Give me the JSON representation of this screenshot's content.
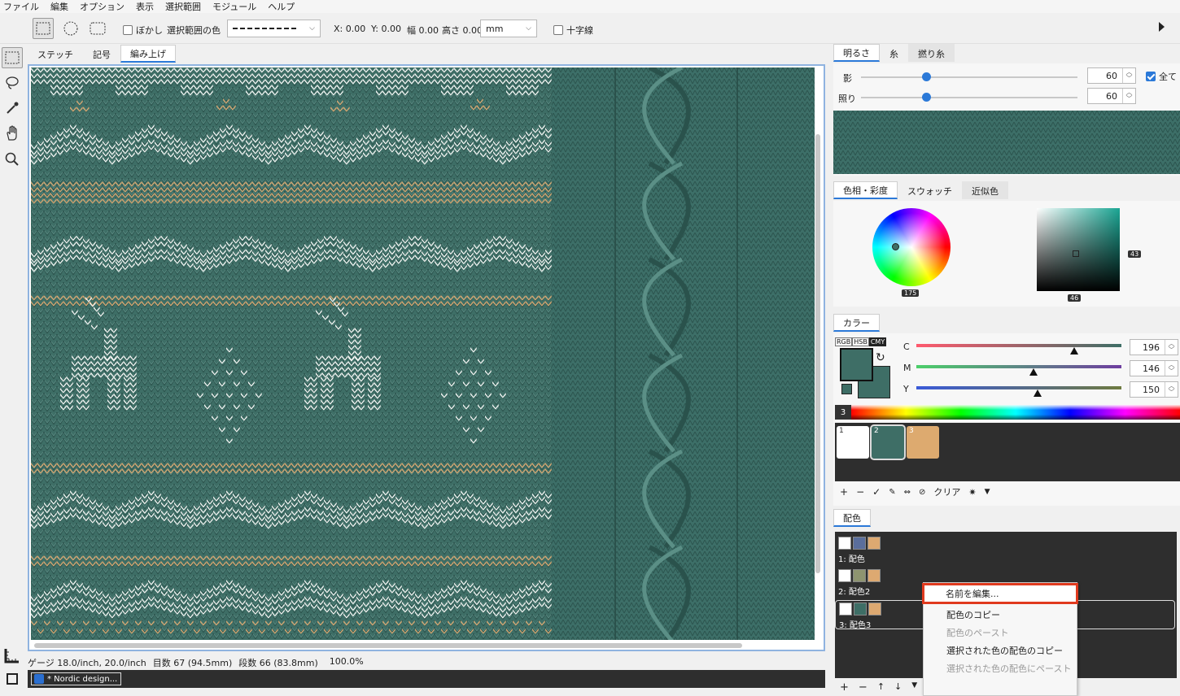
{
  "menu": [
    "ファイル",
    "編集",
    "オプション",
    "表示",
    "選択範囲",
    "モジュール",
    "ヘルプ"
  ],
  "toolbar": {
    "blur_label": "ぼかし",
    "selcolor_label": "選択範囲の色",
    "x": "X: 0.00",
    "y": "Y: 0.00",
    "width": "幅 0.00",
    "height": "高さ 0.00",
    "unit": "mm",
    "crosshair_label": "十字線"
  },
  "canvas_tabs": [
    "ステッチ",
    "記号",
    "編み上げ"
  ],
  "status": {
    "gauge": "ゲージ 18.0/inch, 20.0/inch",
    "stitches": "目数 67 (94.5mm)",
    "rows": "段数 66 (83.8mm)",
    "zoom": "100.0%"
  },
  "doc_tab": "* Nordic design...",
  "yarn_panel": {
    "tabs": [
      "明るさ",
      "糸",
      "撚り糸"
    ],
    "shadow_label": "影",
    "shadow_value": "60",
    "light_label": "照り",
    "light_value": "60",
    "all_label": "全て",
    "shadow_level": 0.3,
    "light_level": 0.3
  },
  "hue_panel": {
    "tabs": [
      "色相・彩度",
      "スウォッチ",
      "近似色"
    ],
    "hue_value": "175",
    "sat_value": "43",
    "bri_value": "46"
  },
  "color_panel": {
    "tab": "カラー",
    "modes": [
      "RGB",
      "HSB",
      "CMY"
    ],
    "sliders": [
      {
        "label": "C",
        "value": "196",
        "pos": 0.77
      },
      {
        "label": "M",
        "value": "146",
        "pos": 0.57
      },
      {
        "label": "Y",
        "value": "150",
        "pos": 0.59
      }
    ],
    "index_label": "3",
    "swatches": [
      {
        "num": "1",
        "color": "#ffffff"
      },
      {
        "num": "2",
        "color": "#3e6e66"
      },
      {
        "num": "3",
        "color": "#ddaa6f"
      }
    ],
    "toolbar_clear": "クリア",
    "fg_color": "#3e6e66",
    "bg_color": "#3e6e66"
  },
  "scheme_panel": {
    "tab": "配色",
    "items": [
      {
        "label": "1: 配色",
        "colors": [
          "#ffffff",
          "#5a6e9c",
          "#dda971"
        ]
      },
      {
        "label": "2: 配色2",
        "colors": [
          "#ffffff",
          "#8e9470",
          "#dda971"
        ]
      },
      {
        "label": "3: 配色3",
        "colors": [
          "#ffffff",
          "#3e6e66",
          "#dda971"
        ]
      }
    ]
  },
  "context_menu": [
    {
      "label": "名前を編集...",
      "enabled": true,
      "highlight": true
    },
    {
      "label": "配色のコピー",
      "enabled": true
    },
    {
      "label": "配色のペースト",
      "enabled": false
    },
    {
      "label": "選択された色の配色のコピー",
      "enabled": true
    },
    {
      "label": "選択された色の配色にペースト",
      "enabled": false
    }
  ],
  "colors": {
    "knit_green": "#3e6e66",
    "accent_orange": "#ddaa6f",
    "highlight_red": "#e03a1e",
    "blue": "#2b79d8"
  }
}
